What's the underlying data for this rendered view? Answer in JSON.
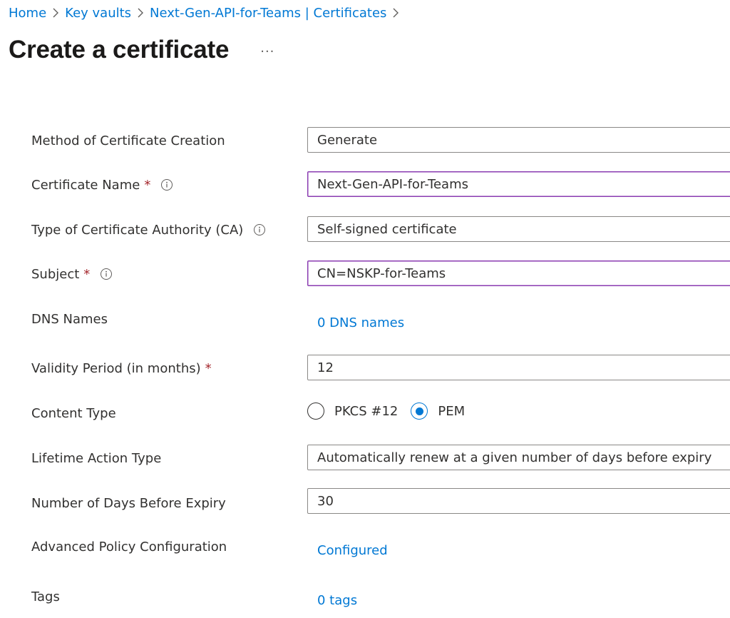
{
  "breadcrumb": {
    "items": [
      "Home",
      "Key vaults",
      "Next-Gen-API-for-Teams | Certificates"
    ]
  },
  "header": {
    "title": "Create a certificate",
    "more_label": "..."
  },
  "form": {
    "method": {
      "label": "Method of Certificate Creation",
      "value": "Generate"
    },
    "cert_name": {
      "label": "Certificate Name",
      "value": "Next-Gen-API-for-Teams"
    },
    "ca_type": {
      "label": "Type of Certificate Authority (CA)",
      "value": "Self-signed certificate"
    },
    "subject": {
      "label": "Subject",
      "value": "CN=NSKP-for-Teams"
    },
    "dns": {
      "label": "DNS Names",
      "link": "0 DNS names"
    },
    "validity": {
      "label": "Validity Period (in months)",
      "value": "12"
    },
    "content_type": {
      "label": "Content Type",
      "options": [
        "PKCS #12",
        "PEM"
      ],
      "selected": "PEM"
    },
    "lifetime_action": {
      "label": "Lifetime Action Type",
      "value": "Automatically renew at a given number of days before expiry"
    },
    "days_before_expiry": {
      "label": "Number of Days Before Expiry",
      "value": "30"
    },
    "advanced_policy": {
      "label": "Advanced Policy Configuration",
      "link": "Configured"
    },
    "tags": {
      "label": "Tags",
      "link": "0 tags"
    }
  },
  "required_marker": "*",
  "colors": {
    "link": "#0078d4",
    "required": "#a4262c",
    "focus_border": "#8a3bb1",
    "border": "#8a8886",
    "text": "#323130"
  },
  "icons": {
    "separator": "chevron-right-icon",
    "info": "info-icon"
  }
}
